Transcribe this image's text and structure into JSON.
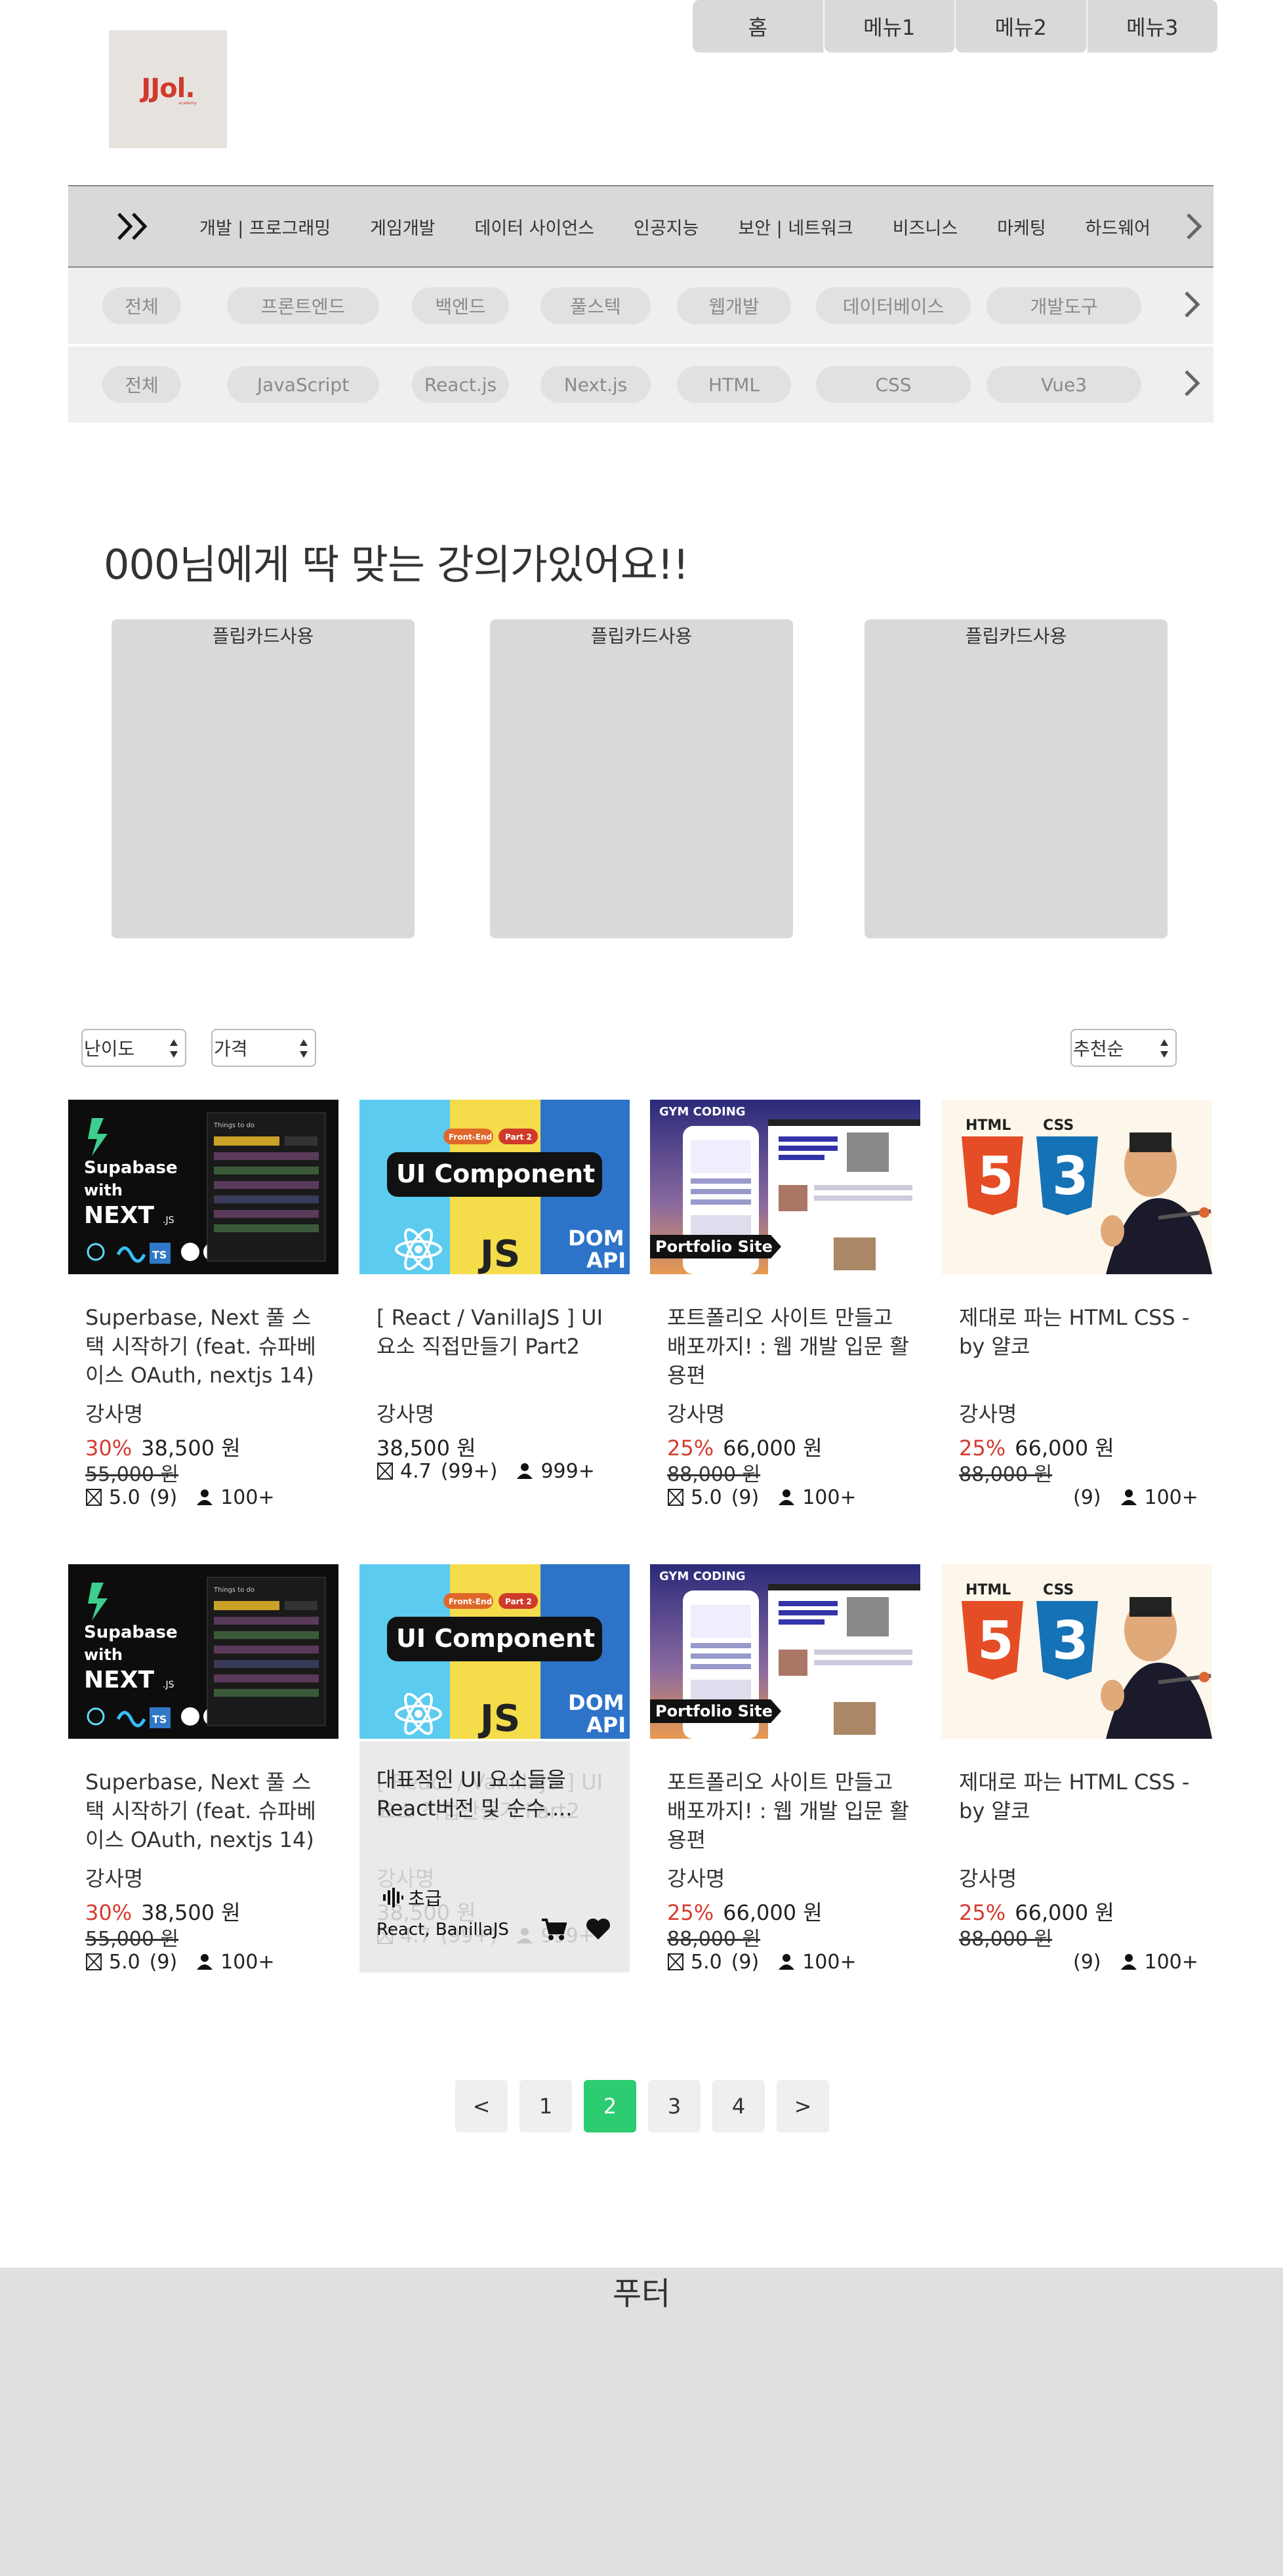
{
  "topnav": [
    "홈",
    "메뉴1",
    "메뉴2",
    "메뉴3"
  ],
  "logo": {
    "text": "JJol.",
    "sub": "academy"
  },
  "categories": [
    "개발 | 프로그래밍",
    "게임개발",
    "데이터 사이언스",
    "인공지능",
    "보안 | 네트워크",
    "비즈니스",
    "마케팅",
    "하드웨어"
  ],
  "subcategories": [
    "전체",
    "프론트엔드",
    "백엔드",
    "풀스텍",
    "웹개발",
    "데이터베이스",
    "개발도구"
  ],
  "tech_tags": [
    "전체",
    "JavaScript",
    "React.js",
    "Next.js",
    "HTML",
    "CSS",
    "Vue3"
  ],
  "section_title": "000님에게 딱 맞는 강의가있어요!!",
  "flipcards": [
    "플립카드사용",
    "플립카드사용",
    "플립카드사용"
  ],
  "filters": {
    "difficulty": "난이도",
    "price": "가격",
    "sort": "추천순"
  },
  "thumbs": {
    "supabase": {
      "line1": "Supabase",
      "line2": "with",
      "line3": "NEXT",
      "sub": ".JS",
      "mock": "Things to do"
    },
    "ui": {
      "badge1": "Front-End",
      "badge2": "Part 2",
      "title": "UI Component",
      "js": "JS",
      "dom1": "DOM",
      "dom2": "API"
    },
    "gym": {
      "brand": "GYM CODING",
      "tag": "Portfolio  Site"
    },
    "html": {
      "html": "HTML",
      "css": "CSS",
      "n5": "5",
      "n3": "3"
    }
  },
  "cards_row1": [
    {
      "title": "Superbase, Next 풀 스택 시작하기 (feat. 슈파베이스 OAuth, nextjs 14)",
      "teacher": "강사명",
      "discount": "30%",
      "price": "38,500 원",
      "old_price": "55,000 원",
      "rating": "5.0",
      "reviews": "(9)",
      "students": "100+"
    },
    {
      "title": "[ React / VanillaJS ] UI 요소 직접만들기 Part2",
      "teacher": "강사명",
      "discount": "",
      "price": "38,500 원",
      "old_price": "",
      "rating": "4.7",
      "reviews": "(99+)",
      "students": "999+"
    },
    {
      "title": "포트폴리오 사이트 만들고 배포까지! : 웹 개발 입문 활용편",
      "teacher": "강사명",
      "discount": "25%",
      "price": "66,000 원",
      "old_price": "88,000 원",
      "rating": "5.0",
      "reviews": "(9)",
      "students": "100+"
    },
    {
      "title": "제대로 파는 HTML CSS - by 얄코",
      "teacher": "강사명",
      "discount": "25%",
      "price": "66,000 원",
      "old_price": "88,000 원",
      "rating": "",
      "reviews": "(9)",
      "students": "100+"
    }
  ],
  "cards_row2": [
    {
      "title": "Superbase, Next 풀 스택 시작하기 (feat. 슈파베이스 OAuth, nextjs 14)",
      "teacher": "강사명",
      "discount": "30%",
      "price": "38,500 원",
      "old_price": "55,000 원",
      "rating": "5.0",
      "reviews": "(9)",
      "students": "100+"
    },
    {
      "title": "[ React / VanillaJS ] UI 요소 직접만들기 Part2",
      "teacher": "강사명",
      "discount": "",
      "price": "38,500 원",
      "old_price": "",
      "rating": "4.7",
      "reviews": "(99+)",
      "students": "999+"
    },
    {
      "title": "포트폴리오 사이트 만들고 배포까지! : 웹 개발 입문 활용편",
      "teacher": "강사명",
      "discount": "25%",
      "price": "66,000 원",
      "old_price": "88,000 원",
      "rating": "5.0",
      "reviews": "(9)",
      "students": "100+"
    },
    {
      "title": "제대로 파는 HTML CSS - by 얄코",
      "teacher": "강사명",
      "discount": "25%",
      "price": "66,000 원",
      "old_price": "88,000 원",
      "rating": "",
      "reviews": "(9)",
      "students": "100+"
    }
  ],
  "hover": {
    "desc": "대표적인 UI 요소들을 React버전 및 순수....",
    "level": "초급",
    "tags": "React, BanillaJS"
  },
  "pagination": {
    "prev": "<",
    "pages": [
      "1",
      "2",
      "3",
      "4"
    ],
    "next": ">",
    "active": "2"
  },
  "footer": "푸터",
  "colors": {
    "accent_green": "#2ecc71",
    "discount_red": "#d43b2e",
    "bar_gray": "#d9d9d9"
  }
}
